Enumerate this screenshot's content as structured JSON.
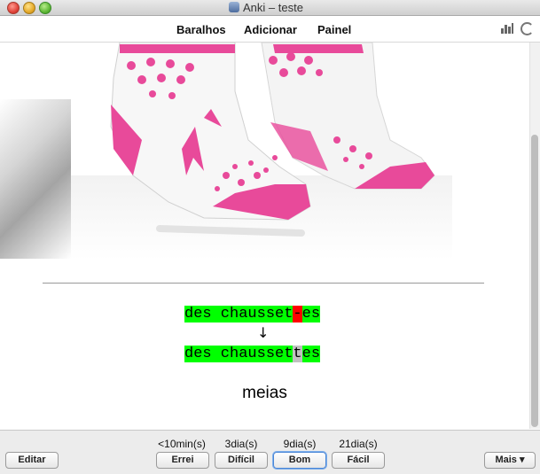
{
  "window": {
    "title": "Anki – teste"
  },
  "toolbar": {
    "decks": "Baralhos",
    "add": "Adicionar",
    "stats": "Painel"
  },
  "card": {
    "typed_segments": [
      {
        "text": "des chausset",
        "status": "good"
      },
      {
        "text": "-",
        "status": "bad"
      },
      {
        "text": "es",
        "status": "good"
      }
    ],
    "arrow": "↓",
    "correct_segments": [
      {
        "text": "des chausset",
        "status": "good"
      },
      {
        "text": "t",
        "status": "missed"
      },
      {
        "text": "es",
        "status": "good"
      }
    ],
    "answer": "meias",
    "colors": {
      "good": "#00ff00",
      "bad": "#ff0000",
      "missed": "#c0c0c0",
      "sock_pink": "#e84a9a"
    }
  },
  "bottom": {
    "edit": "Editar",
    "more": "Mais ▾",
    "answers": [
      {
        "interval": "<10min(s)",
        "label": "Errei"
      },
      {
        "interval": "3dia(s)",
        "label": "Difícil"
      },
      {
        "interval": "9dia(s)",
        "label": "Bom"
      },
      {
        "interval": "21dia(s)",
        "label": "Fácil"
      }
    ]
  }
}
